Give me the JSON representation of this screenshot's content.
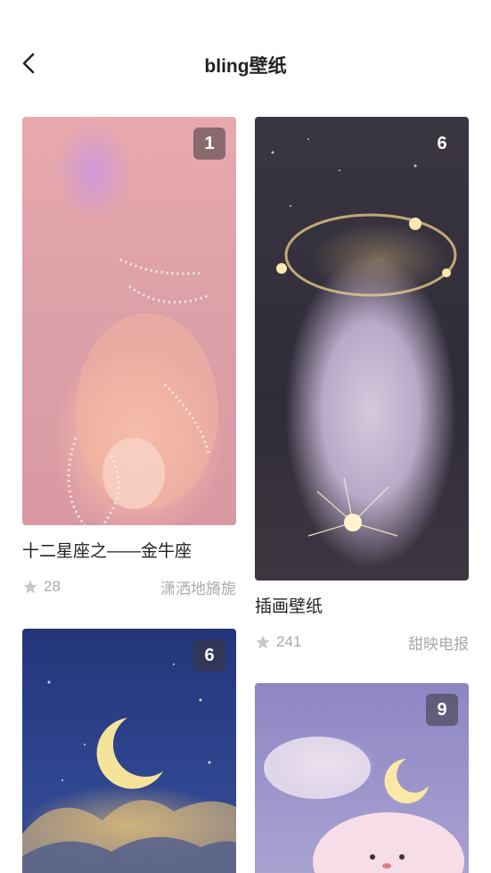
{
  "header": {
    "title": "bling壁纸"
  },
  "cards": [
    {
      "badge": "1",
      "title": "十二星座之——金牛座",
      "stars": "28",
      "author": "潇洒地旖旎"
    },
    {
      "badge": "6",
      "title": "插画壁纸",
      "stars": "241",
      "author": "甜映电报"
    },
    {
      "badge": "6"
    },
    {
      "badge": "9"
    }
  ],
  "icons": {
    "back": "chevron-left-icon",
    "star": "star-icon"
  },
  "colors": {
    "meta_text": "#aaaaaa",
    "badge_bg": "#4a454d"
  }
}
